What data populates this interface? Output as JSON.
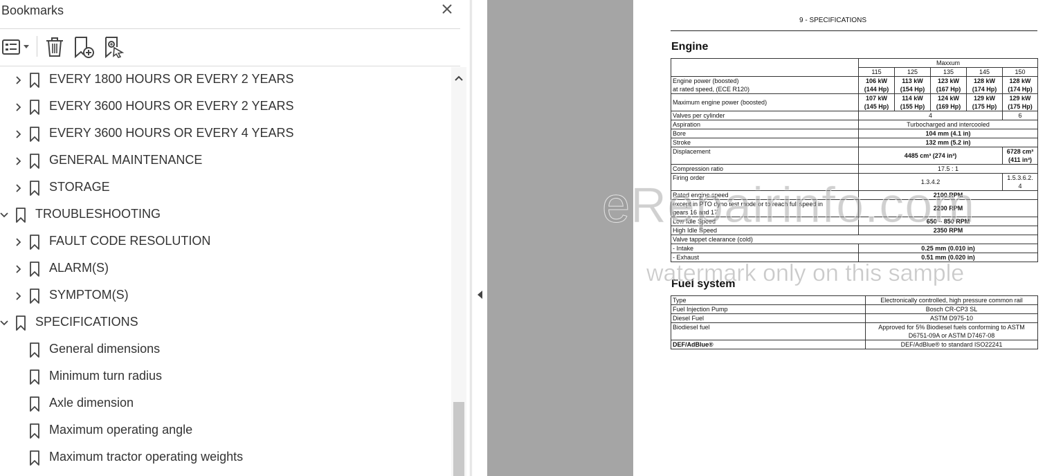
{
  "panel": {
    "title": "Bookmarks",
    "close_icon": "close-icon",
    "toolbar": [
      {
        "icon": "options-list-icon"
      },
      {
        "icon": "delete-icon"
      },
      {
        "icon": "new-bookmark-icon"
      },
      {
        "icon": "search-bookmark-icon"
      }
    ]
  },
  "bookmarks": [
    {
      "label": "EVERY 1800 HOURS OR EVERY 2 YEARS",
      "level": 1,
      "state": "collapsed"
    },
    {
      "label": "EVERY 3600 HOURS OR EVERY 2 YEARS",
      "level": 1,
      "state": "collapsed"
    },
    {
      "label": "EVERY 3600 HOURS OR EVERY 4 YEARS",
      "level": 1,
      "state": "collapsed"
    },
    {
      "label": "GENERAL MAINTENANCE",
      "level": 1,
      "state": "collapsed"
    },
    {
      "label": "STORAGE",
      "level": 1,
      "state": "collapsed"
    },
    {
      "label": "TROUBLESHOOTING",
      "level": 0,
      "state": "expanded"
    },
    {
      "label": "FAULT CODE RESOLUTION",
      "level": 1,
      "state": "collapsed"
    },
    {
      "label": "ALARM(S)",
      "level": 1,
      "state": "collapsed"
    },
    {
      "label": "SYMPTOM(S)",
      "level": 1,
      "state": "collapsed"
    },
    {
      "label": "SPECIFICATIONS",
      "level": 0,
      "state": "expanded"
    },
    {
      "label": "General dimensions",
      "level": 1,
      "state": "leaf"
    },
    {
      "label": "Minimum turn radius",
      "level": 1,
      "state": "leaf"
    },
    {
      "label": "Axle dimension",
      "level": 1,
      "state": "leaf"
    },
    {
      "label": "Maximum operating angle",
      "level": 1,
      "state": "leaf"
    },
    {
      "label": "Maximum tractor operating weights",
      "level": 1,
      "state": "leaf"
    }
  ],
  "document": {
    "header": "9 - SPECIFICATIONS",
    "engine_title": "Engine",
    "engine_table": {
      "group_header": "Maxxum",
      "models": [
        "115",
        "125",
        "135",
        "145",
        "150"
      ],
      "rows": {
        "power_label_1": "Engine power (boosted)",
        "power_label_2": "at rated speed, (ECE R120)",
        "power_values": [
          [
            "106 kW",
            "(144 Hp)"
          ],
          [
            "113 kW",
            "(154 Hp)"
          ],
          [
            "123 kW",
            "(167 Hp)"
          ],
          [
            "128 kW",
            "(174 Hp)"
          ],
          [
            "128 kW",
            "(174 Hp)"
          ]
        ],
        "max_label": "Maximum engine power (boosted)",
        "max_values": [
          [
            "107 kW",
            "(145 Hp)"
          ],
          [
            "114 kW",
            "(155 Hp)"
          ],
          [
            "124 kW",
            "(169 Hp)"
          ],
          [
            "129 kW",
            "(175 Hp)"
          ],
          [
            "129 kW",
            "(175 Hp)"
          ]
        ],
        "valves_label": "Valves per cylinder",
        "valves_a": "4",
        "valves_b": "6",
        "aspiration_label": "Aspiration",
        "aspiration_value": "Turbocharged and intercooled",
        "bore_label": "Bore",
        "bore_value": "104 mm (4.1 in)",
        "stroke_label": "Stroke",
        "stroke_value": "132 mm (5.2 in)",
        "disp_label": "Displacement",
        "disp_a": "4485 cm³ (274 in³)",
        "disp_b1": "6728 cm³",
        "disp_b2": "(411 in³)",
        "comp_label": "Compression ratio",
        "comp_value": "17.5 : 1",
        "firing_label": "Firing order",
        "firing_a": "1.3.4.2",
        "firing_b1": "1.5.3.6.2.",
        "firing_b2": "4",
        "rated_label": "Rated engine speed",
        "rated_value": "2100 RPM",
        "pto_label_1": "except in PTO dyno test mode or to reach full speed in",
        "pto_label_2": "gears 16 and 17",
        "pto_value": "2200 RPM",
        "low_label": "Low Idle Speed",
        "low_value": "650 – 850 RPM",
        "high_label": "High Idle Speed",
        "high_value": "2350 RPM",
        "valve_label": "Valve tappet clearance (cold)",
        "intake_label": "- Intake",
        "intake_value": "0.25 mm (0.010 in)",
        "exhaust_label": "- Exhaust",
        "exhaust_value": "0.51 mm (0.020 in)"
      }
    },
    "fuel_title": "Fuel system",
    "fuel_table": {
      "type_label": "Type",
      "type_value": "Electronically controlled, high pressure common rail",
      "pump_label": "Fuel Injection Pump",
      "pump_value": "Bosch CR-CP3 SL",
      "diesel_label": "Diesel Fuel",
      "diesel_value": "ASTM D975-10",
      "bio_label": "Biodiesel fuel",
      "bio_value_1": "Approved for 5% Biodiesel fuels conforming to ASTM",
      "bio_value_2": "D6751-09A or ASTM D7467-08",
      "def_label": "DEF/AdBlue®",
      "def_value": "DEF/AdBlue® to standard ISO22241"
    }
  },
  "watermark": {
    "line1": "eRepairinfo.com",
    "line2": "watermark only on this sample"
  }
}
